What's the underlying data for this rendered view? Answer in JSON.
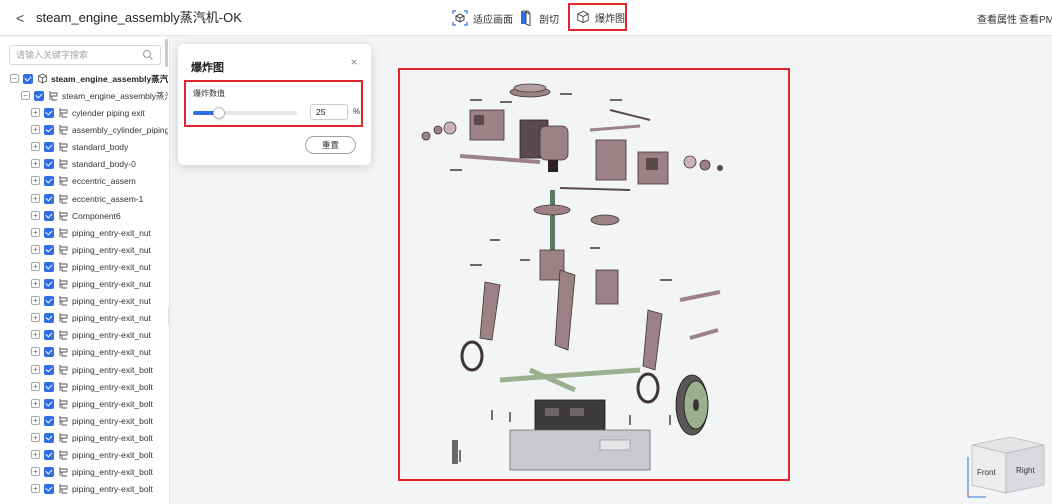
{
  "header": {
    "back_glyph": "<",
    "title": "steam_engine_assembly蒸汽机-OK",
    "title_chevron": "⌄",
    "tools": {
      "fit": "适应画面",
      "section": "剖切",
      "explode": "爆炸图"
    },
    "right": {
      "properties": "查看属性",
      "pmi": "查看PMI"
    }
  },
  "sidebar": {
    "search_placeholder": "请输入关键字搜索",
    "root": "steam_engine_assembly蒸汽机",
    "child": "steam_engine_assembly蒸汽机",
    "items": [
      "cylender piping exit",
      "assembly_cylinder_piping_e",
      "standard_body",
      "standard_body-0",
      "eccentric_assem",
      "eccentric_assem-1",
      "Component6",
      "piping_entry-exit_nut",
      "piping_entry-exit_nut",
      "piping_entry-exit_nut",
      "piping_entry-exit_nut",
      "piping_entry-exit_nut",
      "piping_entry-exit_nut",
      "piping_entry-exit_nut",
      "piping_entry-exit_nut",
      "piping_entry-exit_bolt",
      "piping_entry-exit_bolt",
      "piping_entry-exit_bolt",
      "piping_entry-exit_bolt",
      "piping_entry-exit_bolt",
      "piping_entry-exit_bolt",
      "piping_entry-exit_bolt",
      "piping_entry-exit_bolt"
    ]
  },
  "explode_panel": {
    "title": "爆炸图",
    "close_glyph": "×",
    "value_label": "爆炸数值",
    "value": "25",
    "value_fraction": 0.25,
    "unit": "%",
    "reset": "重置"
  },
  "viewcube": {
    "front": "Front",
    "right": "Right"
  },
  "colors": {
    "accent": "#2f6fe4",
    "highlight": "#e0262b",
    "part_main": "#9c8286",
    "part_dark": "#5a4a4e",
    "part_base": "#c9cacd",
    "part_green": "#9bb08f"
  }
}
